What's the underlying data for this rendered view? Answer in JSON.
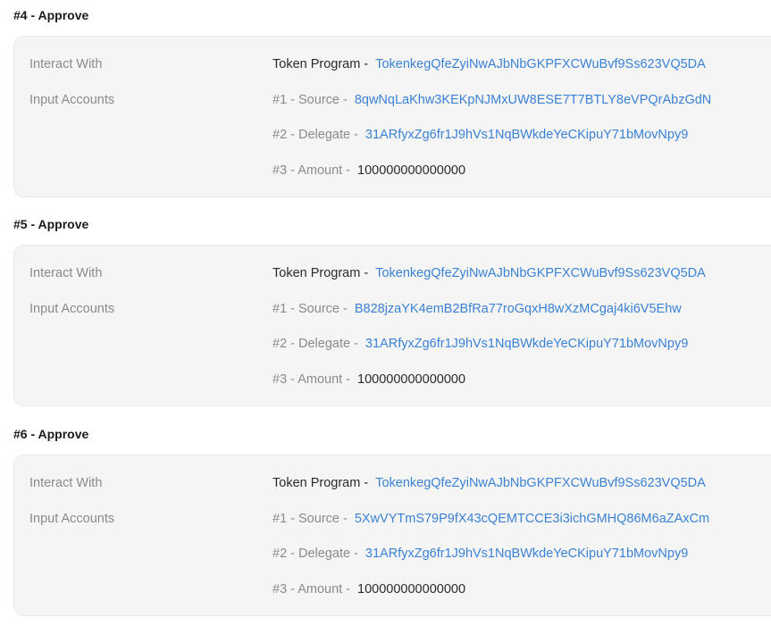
{
  "instructions": [
    {
      "title": "#4 - Approve",
      "interact_label": "Interact With",
      "input_label": "Input Accounts",
      "program_prefix": "Token Program -",
      "program_address": "TokenkegQfeZyiNwAJbNbGKPFXCWuBvf9Ss623VQ5DA",
      "source_prefix": "#1 - Source -",
      "source_address": "8qwNqLaKhw3KEKpNJMxUW8ESE7T7BTLY8eVPQrAbzGdN",
      "delegate_prefix": "#2 - Delegate -",
      "delegate_address": "31ARfyxZg6fr1J9hVs1NqBWkdeYeCKipuY71bMovNpy9",
      "amount_prefix": "#3 - Amount -",
      "amount_value": "100000000000000"
    },
    {
      "title": "#5 - Approve",
      "interact_label": "Interact With",
      "input_label": "Input Accounts",
      "program_prefix": "Token Program -",
      "program_address": "TokenkegQfeZyiNwAJbNbGKPFXCWuBvf9Ss623VQ5DA",
      "source_prefix": "#1 - Source -",
      "source_address": "B828jzaYK4emB2BfRa77roGqxH8wXzMCgaj4ki6V5Ehw",
      "delegate_prefix": "#2 - Delegate -",
      "delegate_address": "31ARfyxZg6fr1J9hVs1NqBWkdeYeCKipuY71bMovNpy9",
      "amount_prefix": "#3 - Amount -",
      "amount_value": "100000000000000"
    },
    {
      "title": "#6 - Approve",
      "interact_label": "Interact With",
      "input_label": "Input Accounts",
      "program_prefix": "Token Program -",
      "program_address": "TokenkegQfeZyiNwAJbNbGKPFXCWuBvf9Ss623VQ5DA",
      "source_prefix": "#1 - Source -",
      "source_address": "5XwVYTmS79P9fX43cQEMTCCE3i3ichGMHQ86M6aZAxCm",
      "delegate_prefix": "#2 - Delegate -",
      "delegate_address": "31ARfyxZg6fr1J9hVs1NqBWkdeYeCKipuY71bMovNpy9",
      "amount_prefix": "#3 - Amount -",
      "amount_value": "100000000000000"
    }
  ],
  "colors": {
    "link": "#3b82d6",
    "card_background": "#f5f5f5",
    "label_grey": "#8a8a8a"
  }
}
